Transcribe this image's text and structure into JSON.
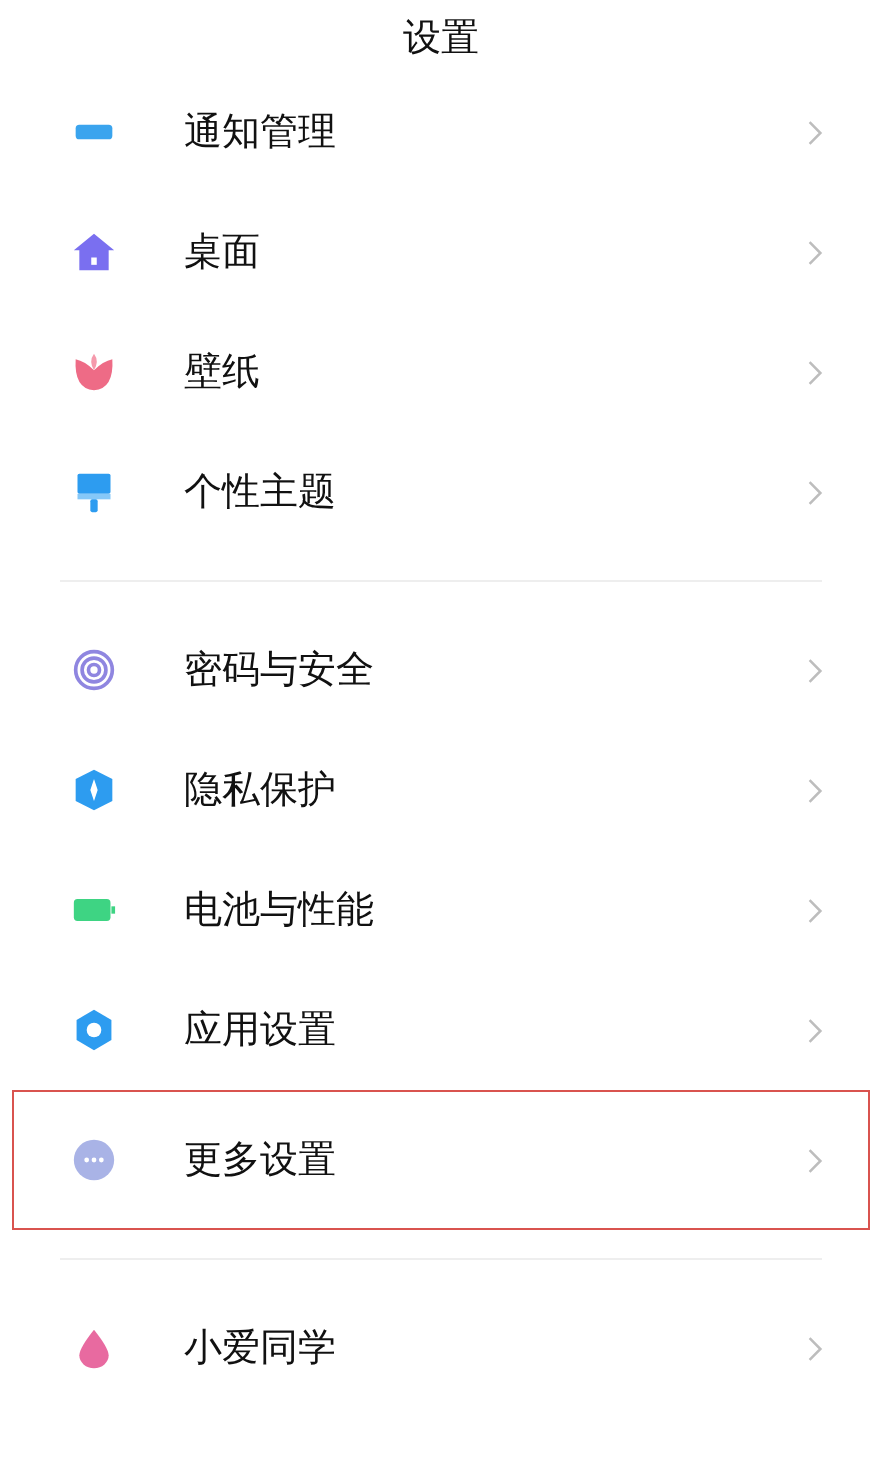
{
  "title": "设置",
  "sections": [
    {
      "items": [
        {
          "label": "通知管理",
          "highlighted": false
        },
        {
          "label": "桌面",
          "highlighted": false
        },
        {
          "label": "壁纸",
          "highlighted": false
        },
        {
          "label": "个性主题",
          "highlighted": false
        }
      ]
    },
    {
      "items": [
        {
          "label": "密码与安全",
          "highlighted": false
        },
        {
          "label": "隐私保护",
          "highlighted": false
        },
        {
          "label": "电池与性能",
          "highlighted": false
        },
        {
          "label": "应用设置",
          "highlighted": false
        },
        {
          "label": "更多设置",
          "highlighted": true
        }
      ]
    },
    {
      "items": [
        {
          "label": "小爱同学",
          "highlighted": false
        }
      ]
    }
  ]
}
